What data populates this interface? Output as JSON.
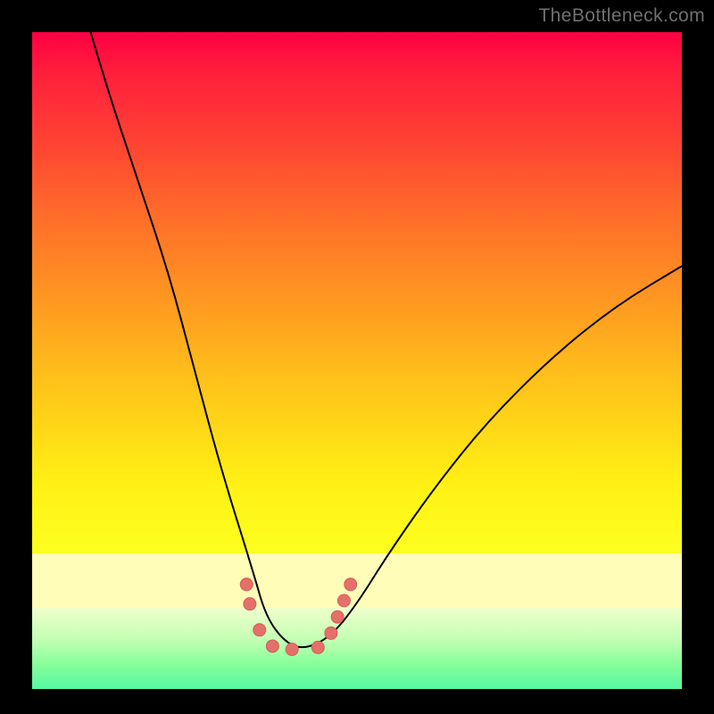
{
  "watermark": "TheBottleneck.com",
  "colors": {
    "curve_stroke": "#000000",
    "marker_fill": "#e47069",
    "marker_stroke": "#d45f58",
    "background_black": "#000000"
  },
  "chart_data": {
    "type": "line",
    "title": "",
    "xlabel": "",
    "ylabel": "",
    "xlim": [
      0,
      100
    ],
    "ylim": [
      0,
      100
    ],
    "note": "No axes or tick labels are visible in the image. Values below are estimated from pixel positions of the V-shaped curve; 0 is the bottom of the gradient panel, 100 is the top.",
    "series": [
      {
        "name": "curve",
        "x": [
          9,
          12,
          16,
          21,
          25,
          29,
          34,
          36,
          39,
          42,
          46,
          50,
          55,
          62,
          70,
          80,
          90,
          100
        ],
        "y": [
          100,
          90,
          78,
          63,
          48,
          33,
          17,
          10,
          6,
          5,
          7,
          12,
          20,
          30,
          40,
          50,
          58,
          64
        ]
      }
    ],
    "markers": {
      "note": "Short string of coral-colored dots near the curve's minimum",
      "points": [
        {
          "x": 33,
          "y": 15
        },
        {
          "x": 33.5,
          "y": 12
        },
        {
          "x": 35,
          "y": 8
        },
        {
          "x": 37,
          "y": 5.5
        },
        {
          "x": 40,
          "y": 5
        },
        {
          "x": 44,
          "y": 5.3
        },
        {
          "x": 46,
          "y": 7.5
        },
        {
          "x": 47,
          "y": 10
        },
        {
          "x": 48,
          "y": 12.5
        },
        {
          "x": 49,
          "y": 15
        }
      ],
      "radius": 7
    }
  }
}
